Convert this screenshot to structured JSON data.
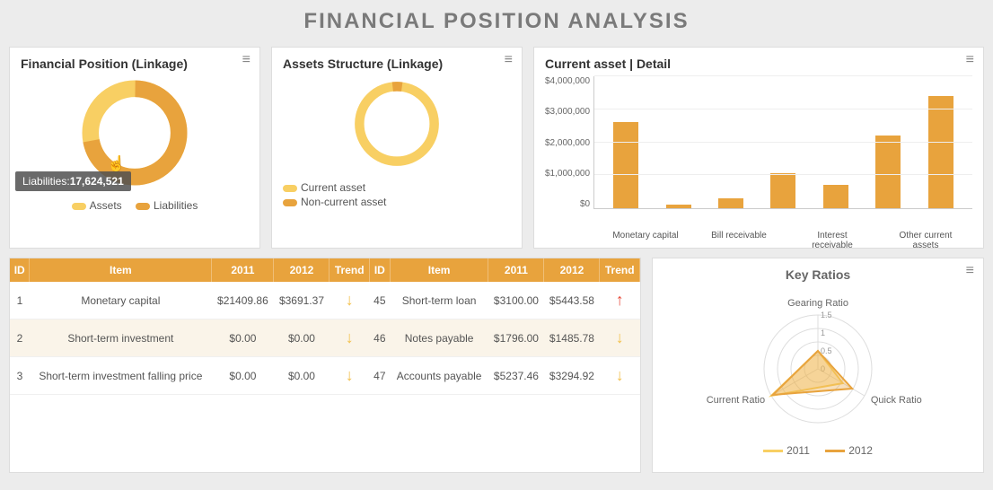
{
  "page_title": "FINANCIAL POSITION ANALYSIS",
  "cards": {
    "financial_position": {
      "title": "Financial Position (Linkage)",
      "tooltip_label": "Liabilities:",
      "tooltip_value": "17,624,521",
      "legend": {
        "assets": "Assets",
        "liabilities": "Liabilities"
      }
    },
    "assets_structure": {
      "title": "Assets Structure (Linkage)",
      "legend": {
        "current": "Current asset",
        "noncurrent": "Non-current asset"
      }
    },
    "bar": {
      "title": "Current asset | Detail"
    },
    "radar": {
      "title": "Key Ratios",
      "axes": {
        "top": "Gearing Ratio",
        "right": "Quick Ratio",
        "left": "Current Ratio"
      },
      "ticks": [
        "0",
        "0.5",
        "1",
        "1.5"
      ],
      "legend": {
        "y2011": "2011",
        "y2012": "2012"
      }
    }
  },
  "table": {
    "headers": [
      "ID",
      "Item",
      "2011",
      "2012",
      "Trend",
      "ID",
      "Item",
      "2011",
      "2012",
      "Trend"
    ],
    "rows": [
      {
        "l_id": "1",
        "l_item": "Monetary capital",
        "l_2011": "$21409.86",
        "l_2012": "$3691.37",
        "l_trend": "down",
        "r_id": "45",
        "r_item": "Short-term loan",
        "r_2011": "$3100.00",
        "r_2012": "$5443.58",
        "r_trend": "up"
      },
      {
        "l_id": "2",
        "l_item": "Short-term investment",
        "l_2011": "$0.00",
        "l_2012": "$0.00",
        "l_trend": "down",
        "r_id": "46",
        "r_item": "Notes payable",
        "r_2011": "$1796.00",
        "r_2012": "$1485.78",
        "r_trend": "down"
      },
      {
        "l_id": "3",
        "l_item": "Short-term investment falling price",
        "l_2011": "$0.00",
        "l_2012": "$0.00",
        "l_trend": "down",
        "r_id": "47",
        "r_item": "Accounts payable",
        "r_2011": "$5237.46",
        "r_2012": "$3294.92",
        "r_trend": "down"
      }
    ]
  },
  "chart_data": [
    {
      "type": "pie",
      "title": "Financial Position (Linkage)",
      "series": [
        {
          "name": "Assets",
          "value": 7000000,
          "color": "#f8cf63"
        },
        {
          "name": "Liabilities",
          "value": 17624521,
          "color": "#e8a33d"
        }
      ]
    },
    {
      "type": "pie",
      "title": "Assets Structure (Linkage)",
      "series": [
        {
          "name": "Current asset",
          "value": 96,
          "color": "#f8cf63"
        },
        {
          "name": "Non-current asset",
          "value": 4,
          "color": "#e8a33d"
        }
      ]
    },
    {
      "type": "bar",
      "title": "Current asset | Detail",
      "ylabel": "",
      "ylim": [
        0,
        4000000
      ],
      "yticks": [
        "$0",
        "$1,000,000",
        "$2,000,000",
        "$3,000,000",
        "$4,000,000"
      ],
      "categories": [
        "Monetary capital",
        "",
        "Bill receivable",
        "",
        "Interest receivable",
        "",
        "Other current assets"
      ],
      "values": [
        2600000,
        100000,
        300000,
        1050000,
        700000,
        2200000,
        3400000
      ]
    },
    {
      "type": "radar",
      "title": "Key Ratios",
      "axes": [
        "Gearing Ratio",
        "Quick Ratio",
        "Current Ratio"
      ],
      "axis_max": 1.5,
      "series": [
        {
          "name": "2011",
          "values": [
            0.5,
            0.8,
            1.5
          ],
          "color": "#f8cf63"
        },
        {
          "name": "2012",
          "values": [
            0.5,
            1.1,
            1.45
          ],
          "color": "#e8a33d"
        }
      ]
    }
  ]
}
